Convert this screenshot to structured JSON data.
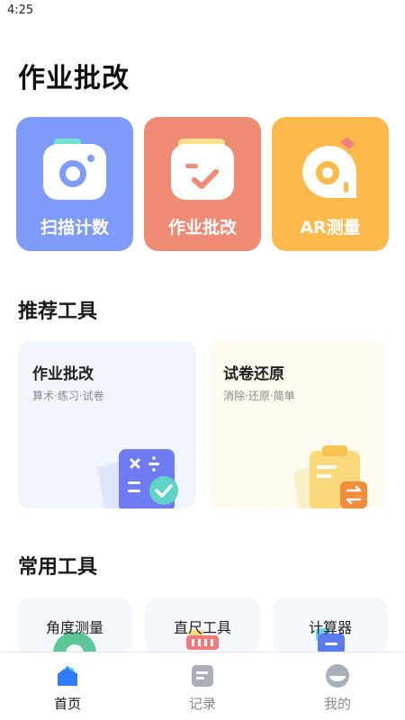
{
  "status_bar": {
    "time": "4:25"
  },
  "page_title": "作业批改",
  "features": [
    {
      "label": "扫描计数",
      "color": "#7e9bf9",
      "icon": "camera-icon"
    },
    {
      "label": "作业批改",
      "color": "#ef8a74",
      "icon": "homework-check-icon"
    },
    {
      "label": "AR测量",
      "color": "#fdb94a",
      "icon": "ar-measure-icon"
    }
  ],
  "recommended": {
    "title": "推荐工具",
    "items": [
      {
        "title": "作业批改",
        "subtitle": "算术·练习·试卷",
        "bg": "#f1f6fe",
        "icon": "calculator-check-icon"
      },
      {
        "title": "试卷还原",
        "subtitle": "消除·还原·简单",
        "bg": "#fffaef",
        "icon": "clipboard-swap-icon"
      }
    ]
  },
  "common": {
    "title": "常用工具",
    "items": [
      {
        "label": "角度测量",
        "icon": "protractor-icon"
      },
      {
        "label": "直尺工具",
        "icon": "ruler-icon"
      },
      {
        "label": "计算器",
        "icon": "calculator-icon"
      }
    ]
  },
  "bottom_nav": {
    "items": [
      {
        "label": "首页",
        "icon": "home-icon",
        "active": true
      },
      {
        "label": "记录",
        "icon": "record-icon",
        "active": false
      },
      {
        "label": "我的",
        "icon": "profile-icon",
        "active": false
      }
    ]
  }
}
